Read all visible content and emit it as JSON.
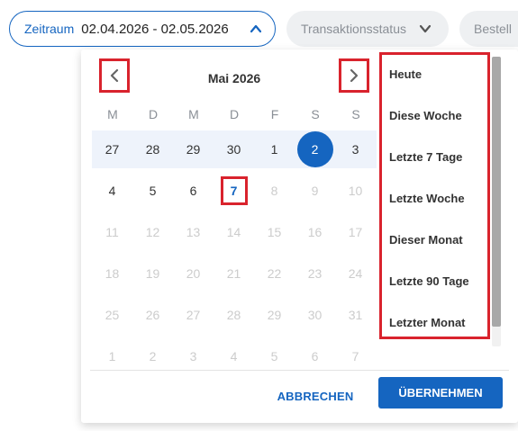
{
  "filters": {
    "range_label": "Zeitraum",
    "range_value": "02.04.2026 - 02.05.2026",
    "status_label": "Transaktionsstatus",
    "order_label": "Bestell"
  },
  "calendar": {
    "month_title": "Mai 2026",
    "weekdays": [
      "M",
      "D",
      "M",
      "D",
      "F",
      "S",
      "S"
    ],
    "weeks": [
      [
        "27",
        "28",
        "29",
        "30",
        "1",
        "2",
        "3"
      ],
      [
        "4",
        "5",
        "6",
        "7",
        "8",
        "9",
        "10"
      ],
      [
        "11",
        "12",
        "13",
        "14",
        "15",
        "16",
        "17"
      ],
      [
        "18",
        "19",
        "20",
        "21",
        "22",
        "23",
        "24"
      ],
      [
        "25",
        "26",
        "27",
        "28",
        "29",
        "30",
        "31"
      ],
      [
        "1",
        "2",
        "3",
        "4",
        "5",
        "6",
        "7"
      ]
    ],
    "selected_day": "2",
    "today": "7"
  },
  "presets": [
    "Heute",
    "Diese Woche",
    "Letzte 7 Tage",
    "Letzte Woche",
    "Dieser Monat",
    "Letzte 90 Tage",
    "Letzter Monat"
  ],
  "actions": {
    "cancel": "ABBRECHEN",
    "apply": "ÜBERNEHMEN"
  },
  "colors": {
    "primary": "#1565c0",
    "highlight": "#d9232d",
    "muted": "#8a8f96"
  }
}
